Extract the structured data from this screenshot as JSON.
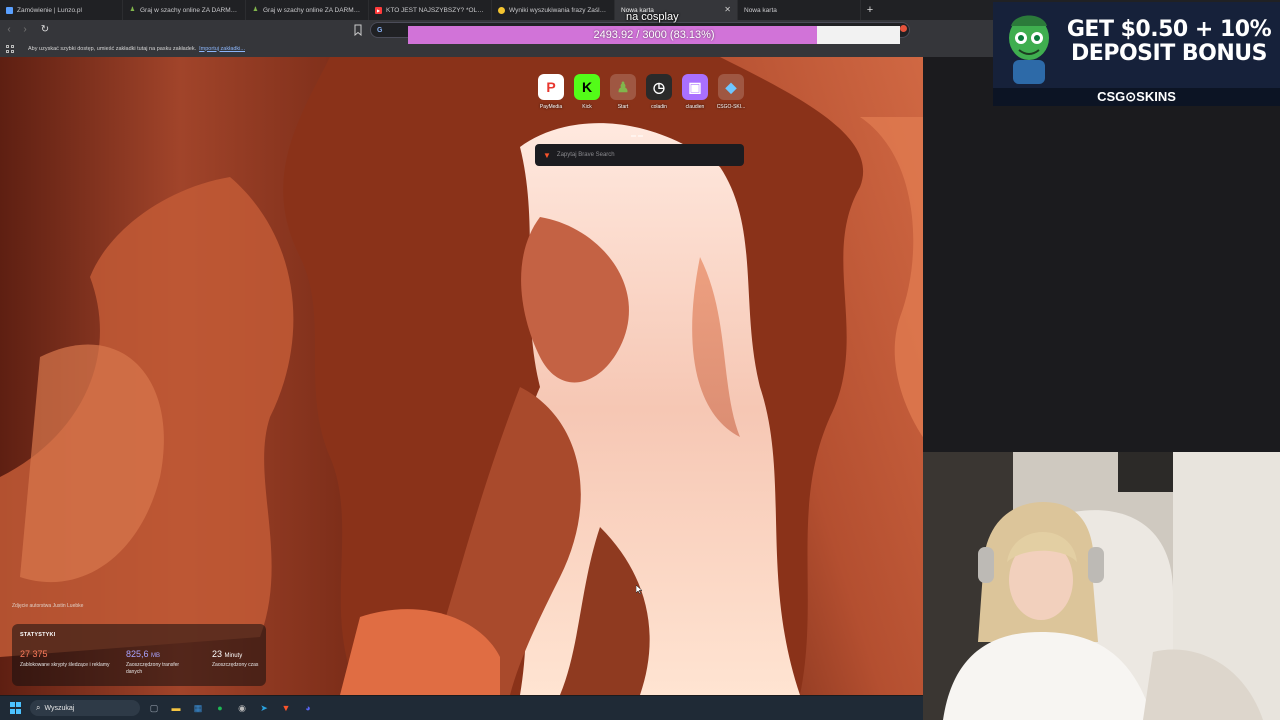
{
  "browser": {
    "tabs": [
      {
        "title": "Zamówienie | Lunzo.pl",
        "favicon": "lunzo-icon",
        "color": "#5aa0ff",
        "glyph": "■"
      },
      {
        "title": "Graj w szachy online ZA DARMO - ...",
        "favicon": "chess-icon",
        "color": "#81b64c",
        "glyph": "♟"
      },
      {
        "title": "Graj w szachy online ZA DARMO - ...",
        "favicon": "chess-icon",
        "color": "#81b64c",
        "glyph": "♟"
      },
      {
        "title": "KTO JEST NAJSZYBSZY? *OLIMPIAD...",
        "favicon": "youtube-icon",
        "color": "#ff3b3b",
        "glyph": "▶"
      },
      {
        "title": "Wyniki wyszukiwania frazy Zaślacz...",
        "favicon": "search-result-icon",
        "color": "#f4c430",
        "glyph": "●"
      },
      {
        "title": "Nowa karta",
        "favicon": "brave-icon",
        "color": "#fb542b",
        "glyph": "",
        "active": true
      },
      {
        "title": "Nowa karta",
        "favicon": "brave-icon",
        "color": "#fb542b",
        "glyph": ""
      }
    ],
    "bookmark_bar": {
      "hint": "Aby uzyskać szybki dostęp, umieść zakładki tutaj na pasku zakładek.",
      "import_link": "Importuj zakładki..."
    }
  },
  "donation_overlay": {
    "label": "na cosplay",
    "progress_text": "2493.92 / 3000 (83.13%)",
    "current": 2493.92,
    "goal": 3000,
    "fraction": 0.8313,
    "fill_color": "#d173d8"
  },
  "new_tab": {
    "shortcuts": [
      {
        "label": "PayMedia",
        "icon": "paymedia-icon",
        "glyph": "P",
        "color": "#e8372f"
      },
      {
        "label": "Kick",
        "icon": "kick-icon",
        "glyph": "K",
        "color": "#53fc18"
      },
      {
        "label": "Start",
        "icon": "chess-icon",
        "glyph": "♟",
        "color": "#81b64c"
      },
      {
        "label": "coladin",
        "icon": "timer-icon",
        "glyph": "◷",
        "color": "#ffffff"
      },
      {
        "label": "claudien",
        "icon": "twitch-icon",
        "glyph": "▣",
        "color": "#a970ff"
      },
      {
        "label": "CSGO-SKI...",
        "icon": "csgo-skins-icon",
        "glyph": "◆",
        "color": "#6ec6ff"
      }
    ],
    "search_placeholder": "Zapytaj Brave Search",
    "photo_credit": "Zdjęcie autorstwa Justin Luebke",
    "stats": {
      "title": "STATYSTYKI",
      "items": [
        {
          "value": "27 375",
          "unit": "",
          "label": "Zablokowane skrypty śledzące i reklamy",
          "color": "#fb7a5c"
        },
        {
          "value": "825,6",
          "unit": "MB",
          "label": "Zaoszczędzony transfer danych",
          "color": "#a9a4ff"
        },
        {
          "value": "23",
          "unit": "Minuty",
          "label": "Zaoszczędzony czas",
          "color": "#ffffff"
        }
      ]
    }
  },
  "taskbar": {
    "search_label": "Wyszukaj",
    "apps": [
      {
        "name": "task-view-icon",
        "glyph": "▢",
        "color": "#9aa4b0"
      },
      {
        "name": "file-explorer-icon",
        "glyph": "▬",
        "color": "#f5c542"
      },
      {
        "name": "store-icon",
        "glyph": "▦",
        "color": "#3a8fd8"
      },
      {
        "name": "spotify-icon",
        "glyph": "●",
        "color": "#1db954"
      },
      {
        "name": "obs-icon",
        "glyph": "◉",
        "color": "#4a4a4a"
      },
      {
        "name": "telegram-icon",
        "glyph": "➤",
        "color": "#2aa3e0"
      },
      {
        "name": "brave-icon",
        "glyph": "▼",
        "color": "#fb542b"
      },
      {
        "name": "discord-icon",
        "glyph": "◕",
        "color": "#5865f2"
      }
    ]
  },
  "ad": {
    "headline_line1": "GET $0.50 + 10%",
    "headline_line2": "DEPOSIT BONUS",
    "brand": "CSG⊙SKINS"
  }
}
